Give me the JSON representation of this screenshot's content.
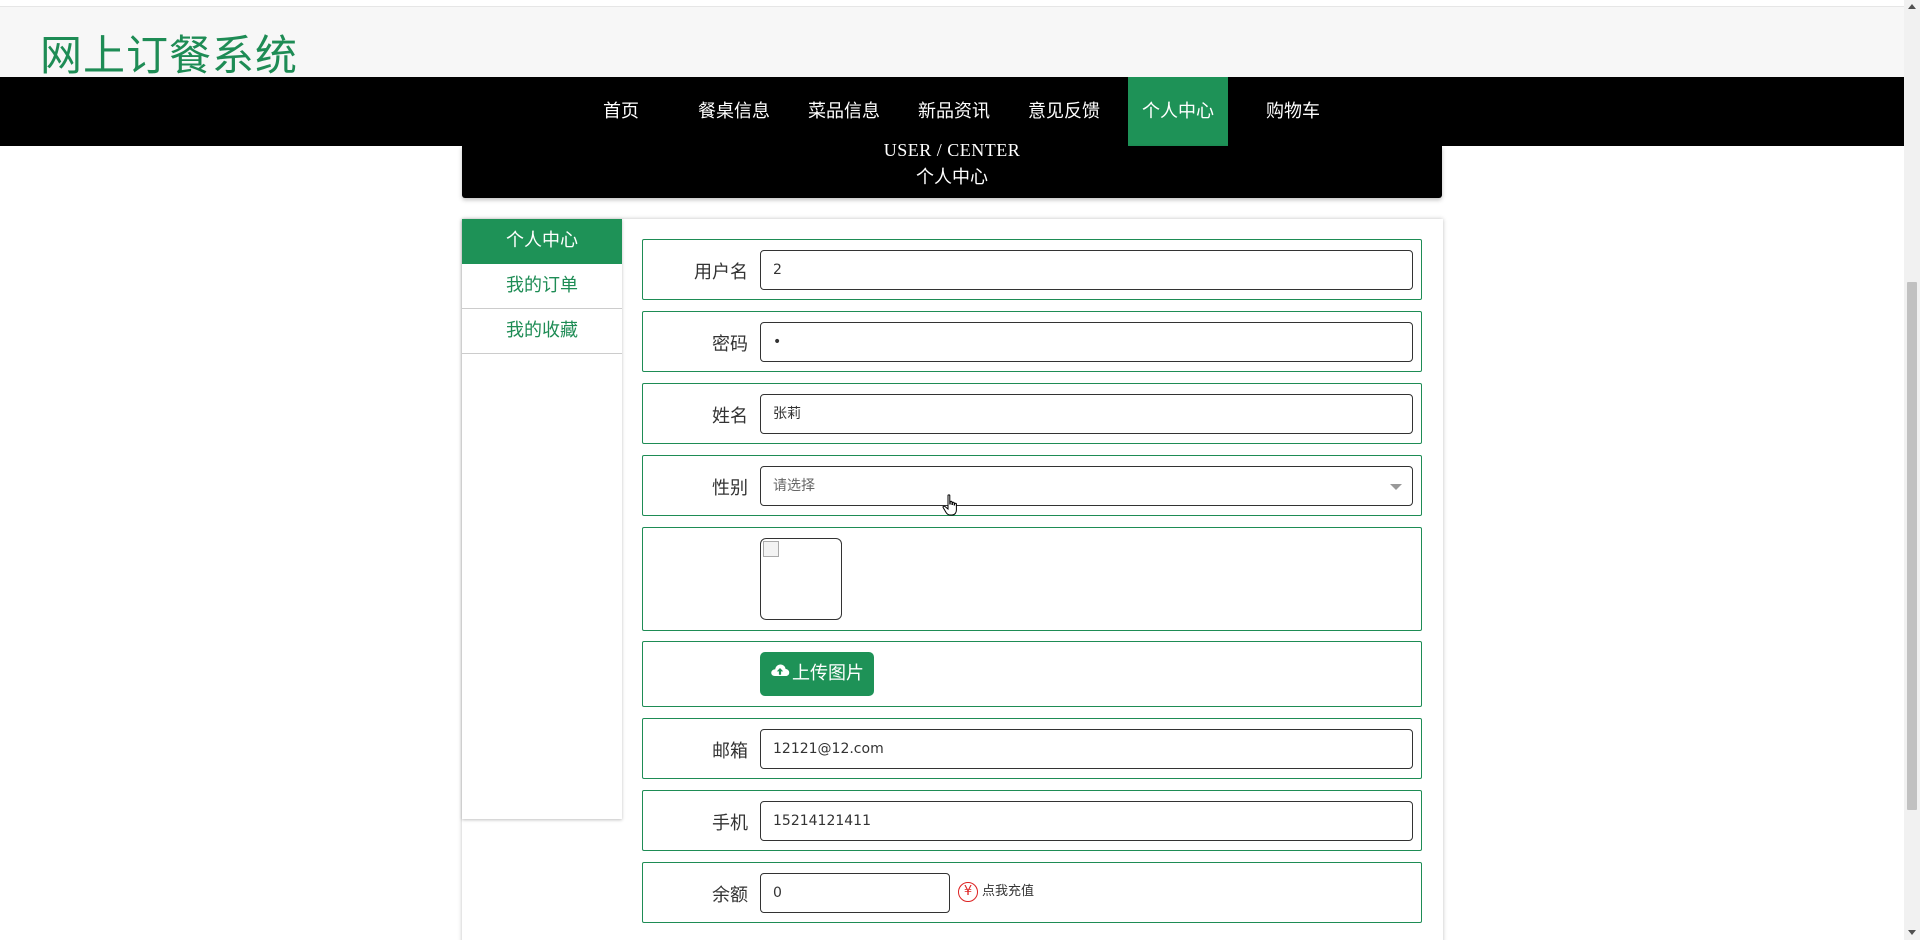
{
  "site_title": "网上订餐系统",
  "nav": {
    "items": [
      {
        "label": "首页",
        "active": false
      },
      {
        "label": "餐桌信息",
        "active": false
      },
      {
        "label": "菜品信息",
        "active": false
      },
      {
        "label": "新品资讯",
        "active": false
      },
      {
        "label": "意见反馈",
        "active": false
      },
      {
        "label": "个人中心",
        "active": true
      },
      {
        "label": "购物车",
        "active": false
      }
    ]
  },
  "banner": {
    "english": "USER / CENTER",
    "chinese": "个人中心"
  },
  "sidebar": {
    "items": [
      {
        "label": "个人中心",
        "active": true
      },
      {
        "label": "我的订单",
        "active": false
      },
      {
        "label": "我的收藏",
        "active": false
      }
    ]
  },
  "form": {
    "username": {
      "label": "用户名",
      "value": "2"
    },
    "password": {
      "label": "密码",
      "value": "•"
    },
    "name": {
      "label": "姓名",
      "value": "张莉"
    },
    "gender": {
      "label": "性别",
      "placeholder": "请选择"
    },
    "avatar": {
      "icon": "broken-image-icon"
    },
    "upload": {
      "label": "上传图片",
      "icon": "cloud-upload-icon"
    },
    "email": {
      "label": "邮箱",
      "value": "12121@12.com"
    },
    "phone": {
      "label": "手机",
      "value": "15214121411"
    },
    "balance": {
      "label": "余额",
      "value": "0",
      "recharge_label": "点我充值",
      "recharge_icon": "yen-icon",
      "recharge_symbol": "¥"
    }
  },
  "colors": {
    "brand_green": "#1e9257",
    "title_green": "#1e8c55",
    "nav_bg": "#000000",
    "recharge_red": "#dd2222"
  }
}
